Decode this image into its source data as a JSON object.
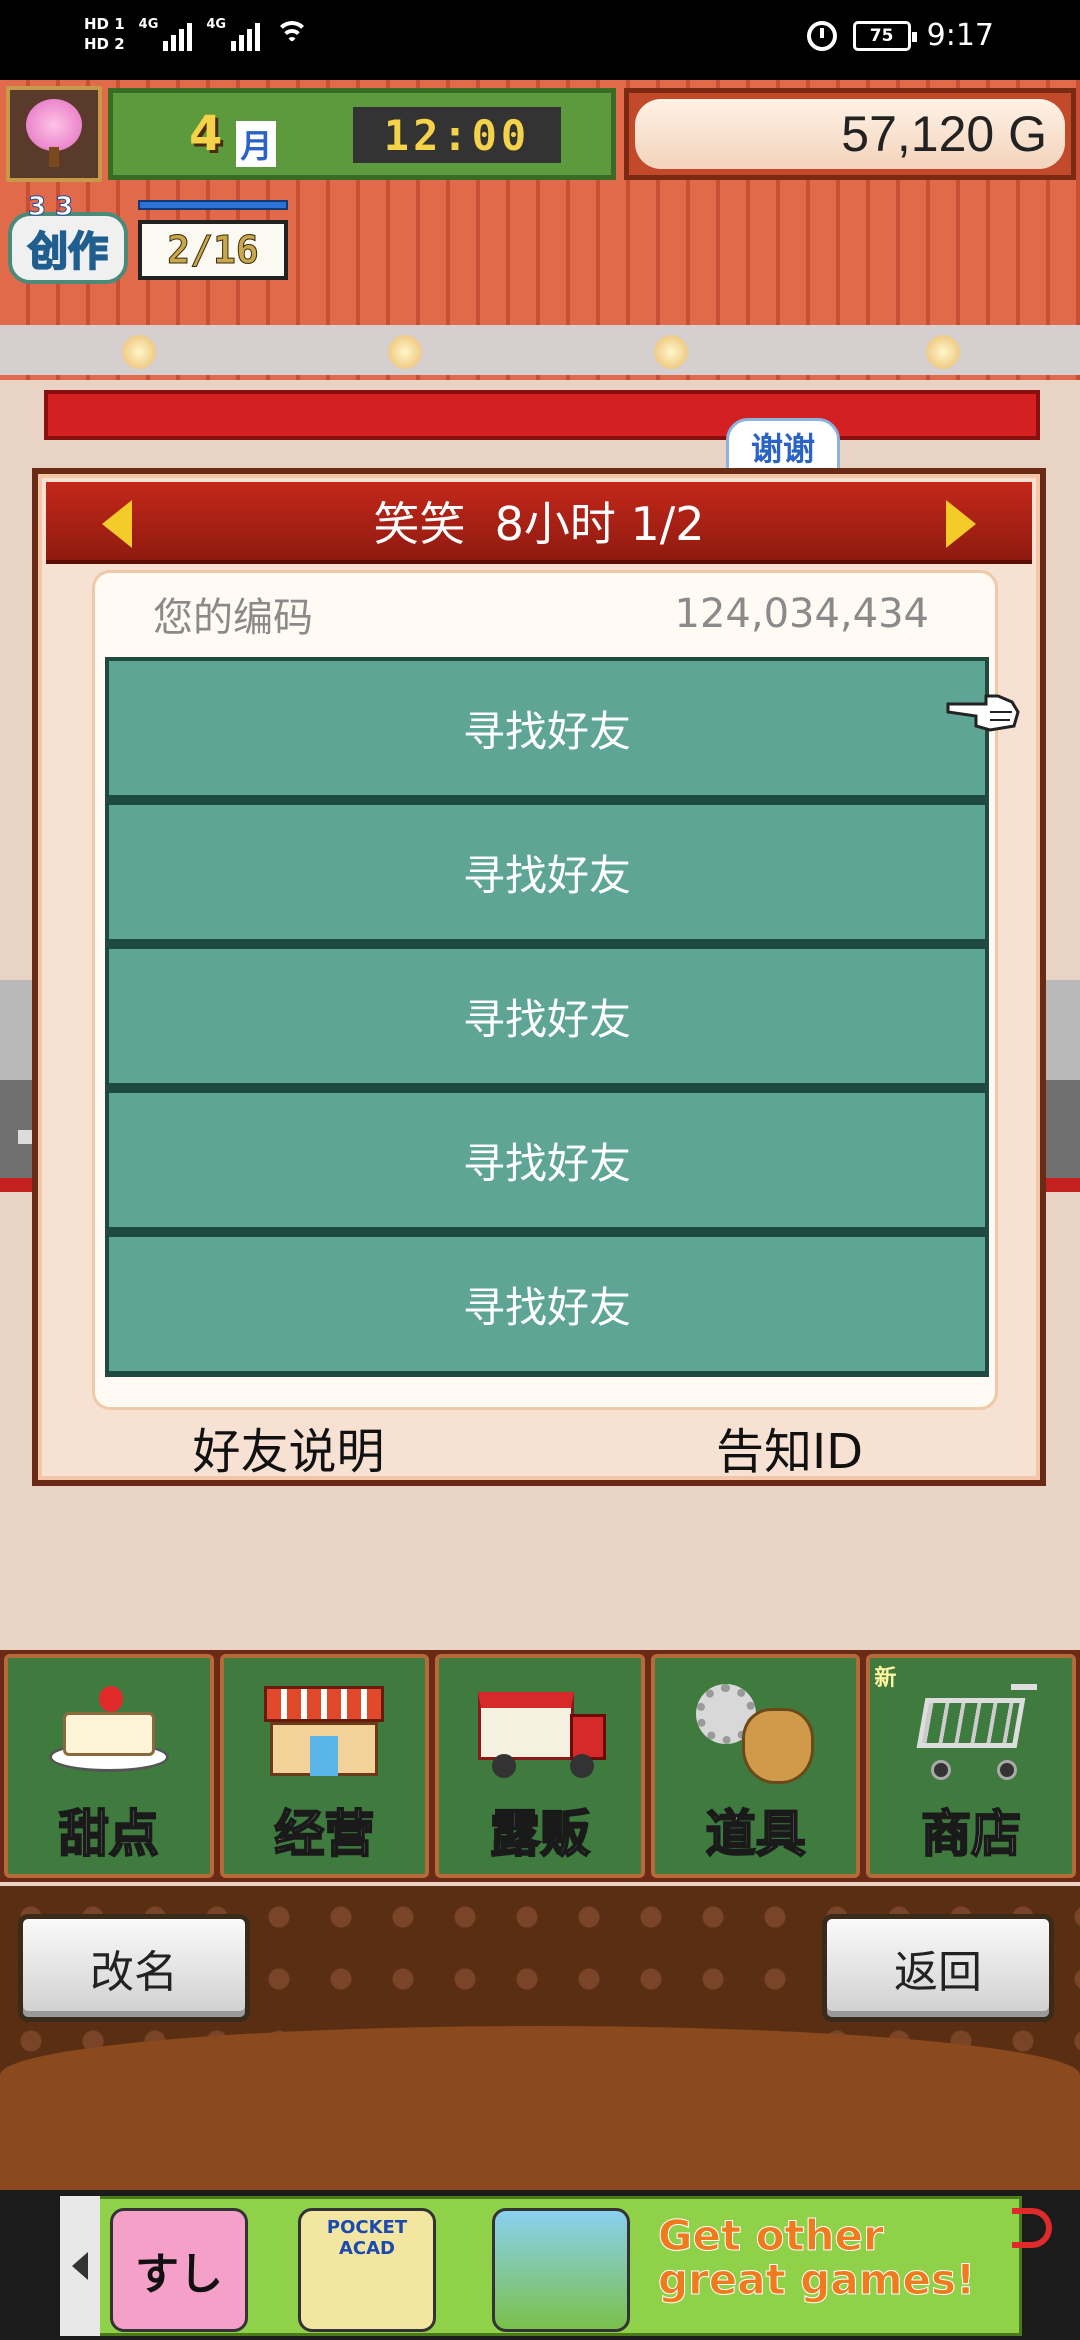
{
  "status_bar": {
    "sim1": "HD 1",
    "sim2": "HD 2",
    "network1": "4G",
    "network2": "4G",
    "battery": "75",
    "time": "9:17"
  },
  "hud": {
    "month_number": "4",
    "month_label": "月",
    "clock": "12:00",
    "money": "57,120 G",
    "create": {
      "level": "3 3",
      "label": "创作",
      "count": "2/16"
    }
  },
  "thanks_tab": "谢谢",
  "dialog": {
    "title": "笑笑  8小时 1/2",
    "code_label": "您的编码",
    "code_value": "124,034,434",
    "friend_slots": [
      {
        "label": "寻找好友"
      },
      {
        "label": "寻找好友"
      },
      {
        "label": "寻找好友"
      },
      {
        "label": "寻找好友"
      },
      {
        "label": "寻找好友"
      }
    ],
    "footer": {
      "help": "好友说明",
      "notify_id": "告知ID"
    }
  },
  "tabs": [
    {
      "label": "甜点",
      "icon": "cake-icon"
    },
    {
      "label": "经营",
      "icon": "shop-icon"
    },
    {
      "label": "露贩",
      "icon": "food-truck-icon"
    },
    {
      "label": "道具",
      "icon": "tools-bag-icon"
    },
    {
      "label": "商店",
      "icon": "shopping-cart-icon",
      "badge": "新"
    }
  ],
  "controls": {
    "rename": "改名",
    "back": "返回"
  },
  "ad_banner": {
    "app1": "すし",
    "app2": "POCKET ACAD",
    "cta": "Get other great games!"
  },
  "colors": {
    "slot_teal": "#5ea596",
    "header_red": "#c4281a",
    "dialog_bg": "#f6e1d3",
    "tab_green": "#3f7a3f"
  }
}
